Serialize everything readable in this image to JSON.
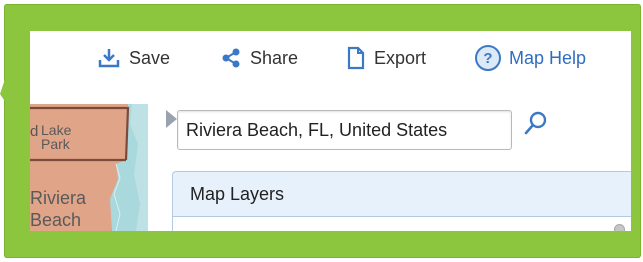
{
  "toolbar": {
    "save_label": "Save",
    "share_label": "Share",
    "export_label": "Export",
    "help_label": "Map Help",
    "help_glyph": "?"
  },
  "map": {
    "place_lake_park": "Lake\nPark",
    "place_riviera": "Riviera",
    "place_beach": "Beach",
    "place_partial": "d"
  },
  "search": {
    "value": "Riviera Beach, FL, United States"
  },
  "layers": {
    "title": "Map Layers"
  },
  "colors": {
    "callout_green": "#8cc63f",
    "toolbar_icon_blue": "#3b78c6",
    "land": "#e0a488",
    "water": "#a9d8dd",
    "panel_bg": "#e7f1fc"
  },
  "icons": [
    "download-icon",
    "share-icon",
    "document-icon",
    "help-icon",
    "search-icon",
    "collapse-arrow-icon"
  ]
}
